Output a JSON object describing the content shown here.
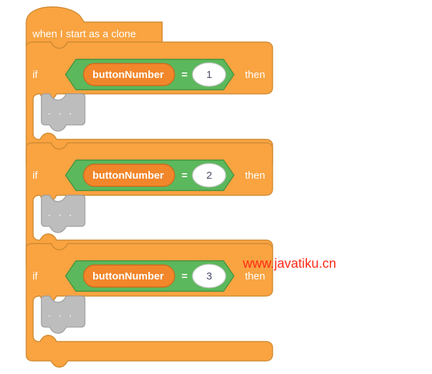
{
  "colors": {
    "control_block": "#f9a341",
    "control_block_stroke": "#cf8b33",
    "operator_block": "#5cb85c",
    "operator_block_stroke": "#43933f",
    "variable_block": "#f2862a",
    "variable_block_stroke": "#c96b1d",
    "input_oval": "#ffffff",
    "input_oval_stroke": "#c8c8c8",
    "placeholder_block": "#bdbdbd",
    "placeholder_block_stroke": "#9e9e9e",
    "text_light": "#ffffff",
    "number_text": "#4a4a6a",
    "watermark": "#ff2a16",
    "canvas_bg": "#ffffff"
  },
  "script": {
    "hat": {
      "label": "when I start as a clone"
    },
    "branches": [
      {
        "if_label": "if",
        "then_label": "then",
        "condition": {
          "variable": "buttonNumber",
          "operator": "=",
          "value": "1"
        },
        "body": {
          "placeholder": "· · ·"
        }
      },
      {
        "if_label": "if",
        "then_label": "then",
        "condition": {
          "variable": "buttonNumber",
          "operator": "=",
          "value": "2"
        },
        "body": {
          "placeholder": "· · ·"
        }
      },
      {
        "if_label": "if",
        "then_label": "then",
        "condition": {
          "variable": "buttonNumber",
          "operator": "=",
          "value": "3"
        },
        "body": {
          "placeholder": "· · ·"
        }
      }
    ]
  },
  "watermark": {
    "text": "www.javatiku.cn"
  }
}
